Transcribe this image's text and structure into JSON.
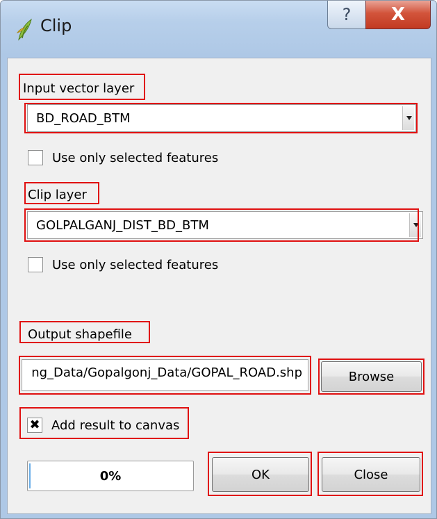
{
  "window": {
    "title": "Clip",
    "help_glyph": "?",
    "close_glyph": "X"
  },
  "input_vector_layer": {
    "label": "Input vector layer",
    "selected_value": "BD_ROAD_BTM",
    "use_selected_label": "Use only selected features",
    "use_selected_checked": false
  },
  "clip_layer": {
    "label": "Clip layer",
    "selected_value": "GOLPALGANJ_DIST_BD_BTM",
    "use_selected_label": "Use only selected features",
    "use_selected_checked": false
  },
  "output": {
    "label": "Output shapefile",
    "path_value": "ng_Data/Gopalgonj_Data/GOPAL_ROAD.shp",
    "browse_label": "Browse"
  },
  "add_to_canvas": {
    "label": "Add result to canvas",
    "checked": true,
    "check_glyph": "✖"
  },
  "footer": {
    "progress_percent": 0,
    "progress_text": "0%",
    "ok_label": "OK",
    "close_label": "Close"
  },
  "colors": {
    "highlight": "#e01010",
    "title_bar": "#b7cfea",
    "close_button": "#c23a22"
  },
  "icons": {
    "app_icon": "qgis-leaf-icon",
    "help": "help-icon",
    "close": "close-icon"
  }
}
